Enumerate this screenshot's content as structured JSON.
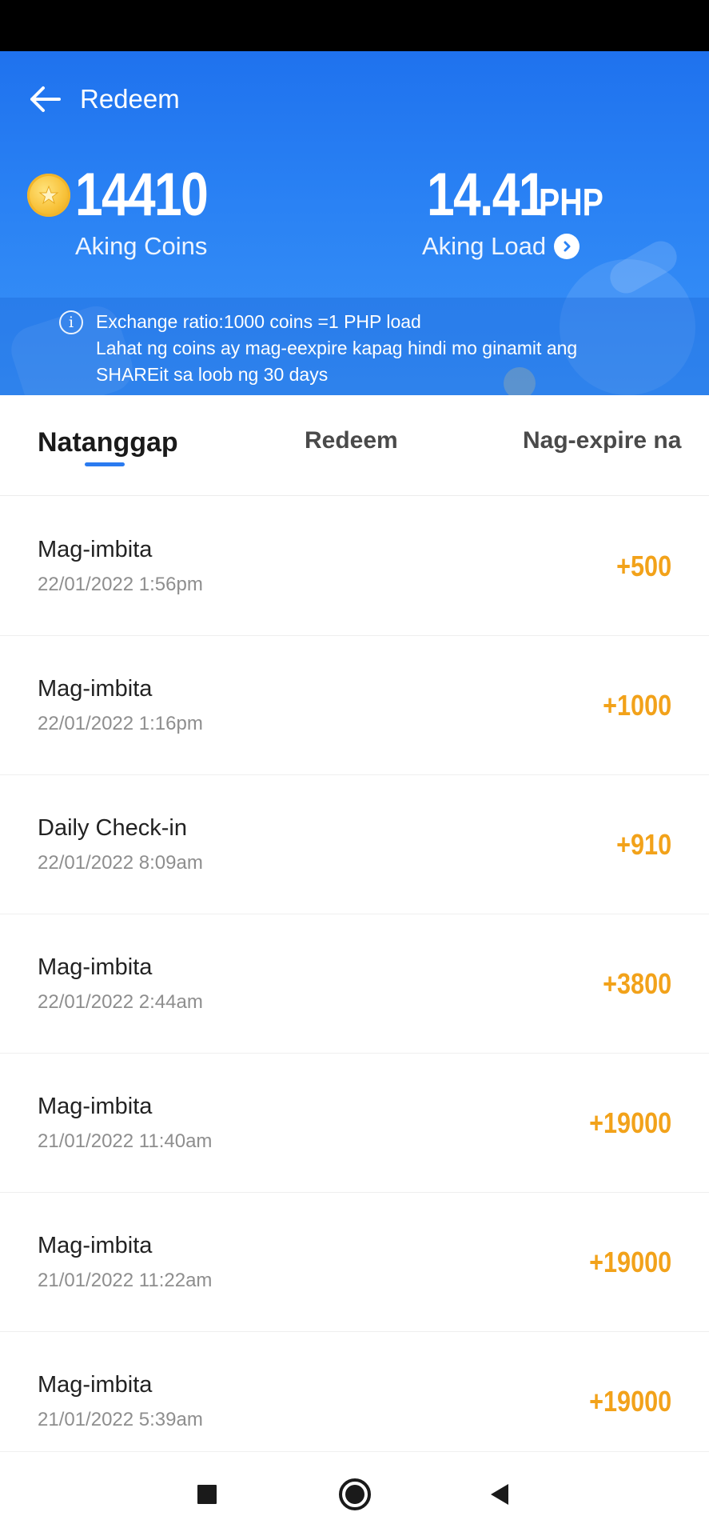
{
  "header": {
    "title": "Redeem",
    "coins_value": "14410",
    "coins_caption": "Aking Coins",
    "load_value": "14.41",
    "load_unit": "PHP",
    "load_caption": "Aking Load",
    "info_lines": [
      "Exchange ratio:1000 coins =1 PHP load",
      "Lahat ng coins ay mag-eexpire kapag hindi mo ginamit ang",
      "SHAREit sa loob ng 30 days"
    ],
    "colors": {
      "primary": "#2a82f4",
      "accent_coin": "#f8c23a"
    },
    "icons": [
      "back-arrow-icon",
      "coin-icon",
      "chevron-right-circle-icon",
      "info-icon"
    ]
  },
  "tabs": [
    {
      "label": "Natanggap",
      "active": true
    },
    {
      "label": "Redeem",
      "active": false
    },
    {
      "label": "Nag-expire na",
      "active": false
    }
  ],
  "transactions": [
    {
      "title": "Mag-imbita",
      "date": "22/01/2022 1:56pm",
      "amount": "+500"
    },
    {
      "title": "Mag-imbita",
      "date": "22/01/2022 1:16pm",
      "amount": "+1000"
    },
    {
      "title": "Daily Check-in",
      "date": "22/01/2022 8:09am",
      "amount": "+910"
    },
    {
      "title": "Mag-imbita",
      "date": "22/01/2022 2:44am",
      "amount": "+3800"
    },
    {
      "title": "Mag-imbita",
      "date": "21/01/2022 11:40am",
      "amount": "+19000"
    },
    {
      "title": "Mag-imbita",
      "date": "21/01/2022 11:22am",
      "amount": "+19000"
    },
    {
      "title": "Mag-imbita",
      "date": "21/01/2022 5:39am",
      "amount": "+19000"
    }
  ],
  "amount_color": "#f2a21a",
  "nav": {
    "icons": [
      "square-icon",
      "circle-home-icon",
      "triangle-back-icon"
    ]
  }
}
